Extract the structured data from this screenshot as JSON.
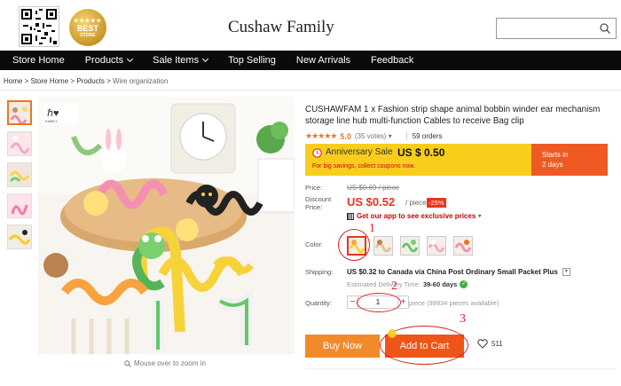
{
  "header": {
    "store_name": "Cushaw Family",
    "badge": {
      "text": "BEST",
      "stars": "★★★★★",
      "sub": "STORE"
    },
    "search_placeholder": ""
  },
  "nav": [
    {
      "label": "Store Home"
    },
    {
      "label": "Products",
      "dropdown": true
    },
    {
      "label": "Sale Items",
      "dropdown": true
    },
    {
      "label": "Top Selling"
    },
    {
      "label": "New Arrivals"
    },
    {
      "label": "Feedback"
    }
  ],
  "breadcrumb": {
    "home": "Home",
    "sep": ">",
    "store_home": "Store Home",
    "products": "Products",
    "current": "Wire organization"
  },
  "image": {
    "zoom_hint": "Mouse over to zoom in",
    "watermark": "FAMILY"
  },
  "product": {
    "title": "CUSHAWFAM 1 x Fashion strip shape animal bobbin winder ear mechanism storage line hub multi-function Cables to receive Bag clip",
    "stars": "★★★★★",
    "rating": "5.0",
    "votes": "(35 votes)",
    "votes_dropdown": "▾",
    "orders": "59 orders"
  },
  "sale": {
    "label": "Anniversary Sale",
    "price": "US $ 0.50",
    "note": "For big savings, collect coupons now.",
    "starts_label": "Starts in",
    "starts_value": "2 days"
  },
  "price": {
    "price_label": "Price:",
    "old_price": "US $0.69 / piece",
    "discount_label": "Discount Price:",
    "new_price": "US $0.52",
    "unit": "/ piece",
    "discount": "-25%",
    "app_text": "Get our app to see exclusive prices",
    "app_dropdown": "▾"
  },
  "color": {
    "label": "Color:",
    "options": 5,
    "selected_index": 0
  },
  "shipping": {
    "label": "Shipping:",
    "text": "US $0.32 to Canada via China Post Ordinary Small Packet Plus",
    "dropdown": "▾",
    "est_label": "Estimated Delivery Time:",
    "est_value": "39-60 days",
    "ok": "✓"
  },
  "quantity": {
    "label": "Quantity:",
    "minus": "−",
    "value": "1",
    "plus": "+",
    "available": "piece (99934 pieces available)"
  },
  "actions": {
    "buy_now": "Buy Now",
    "add_to_cart": "Add to Cart",
    "wish_count": "511"
  },
  "annotations": {
    "n1": "1",
    "n2": "2",
    "n3": "3"
  },
  "colors": {
    "accent": "#e87722",
    "sale_bg": "#f9cd1b",
    "cart": "#ee5518",
    "buy": "#f08a2a",
    "price_red": "#e8331d",
    "annotation": "#e02020"
  }
}
